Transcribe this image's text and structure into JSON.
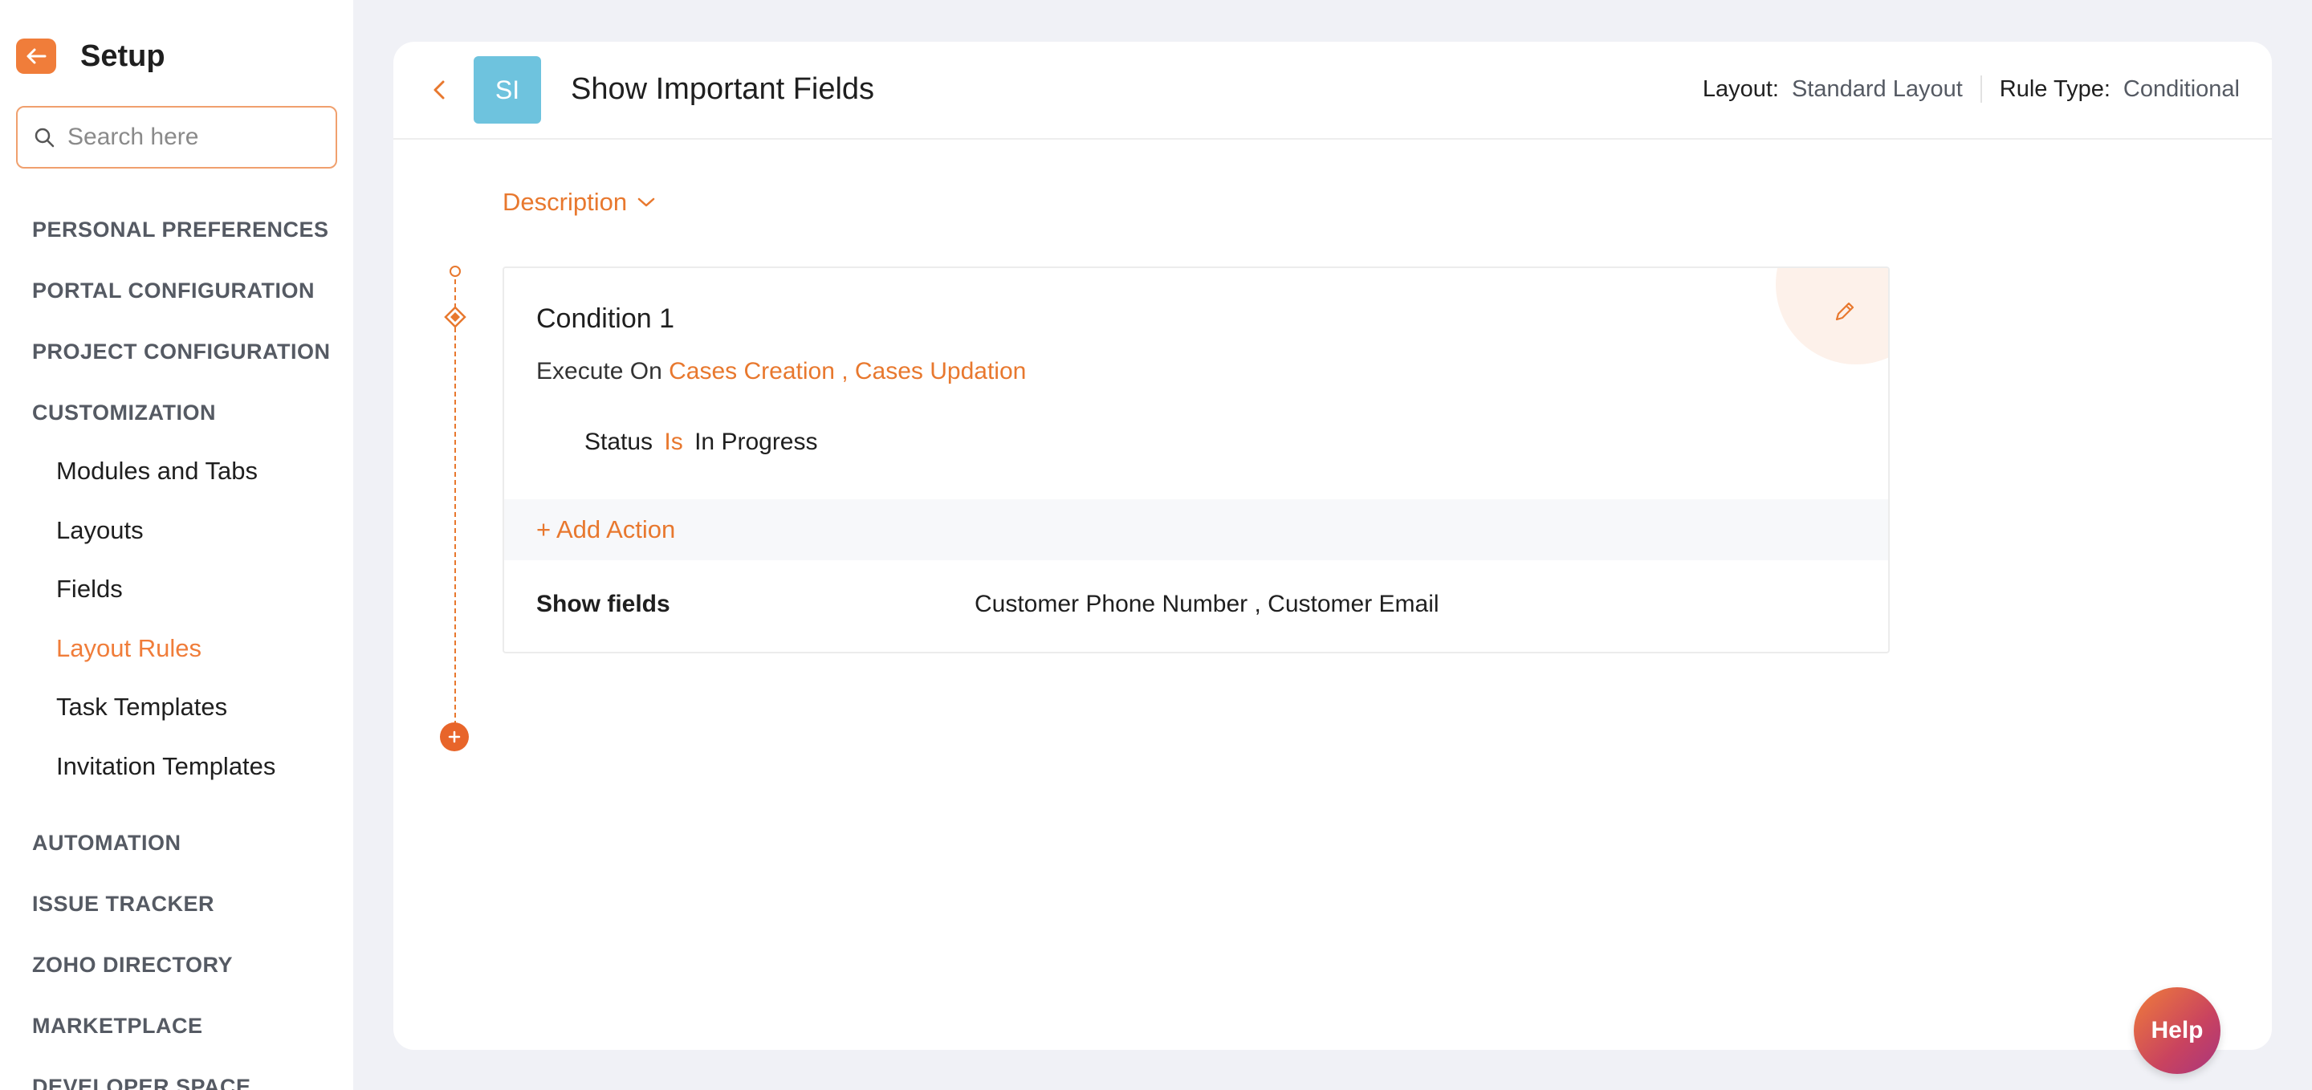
{
  "sidebar": {
    "title": "Setup",
    "search_placeholder": "Search here",
    "sections": [
      {
        "label": "PERSONAL PREFERENCES"
      },
      {
        "label": "PORTAL CONFIGURATION"
      },
      {
        "label": "PROJECT CONFIGURATION"
      },
      {
        "label": "CUSTOMIZATION"
      },
      {
        "label": "AUTOMATION"
      },
      {
        "label": "ISSUE TRACKER"
      },
      {
        "label": "ZOHO DIRECTORY"
      },
      {
        "label": "MARKETPLACE"
      },
      {
        "label": "DEVELOPER SPACE"
      }
    ],
    "customization_items": [
      {
        "label": "Modules and Tabs"
      },
      {
        "label": "Layouts"
      },
      {
        "label": "Fields"
      },
      {
        "label": "Layout Rules",
        "active": true
      },
      {
        "label": "Task Templates"
      },
      {
        "label": "Invitation Templates"
      }
    ]
  },
  "header": {
    "avatar_initials": "SI",
    "title": "Show Important Fields",
    "layout_label": "Layout:",
    "layout_value": "Standard Layout",
    "rule_type_label": "Rule Type:",
    "rule_type_value": "Conditional"
  },
  "description_label": "Description",
  "condition": {
    "title": "Condition 1",
    "execute_on_label": "Execute On",
    "execute_on_value": "Cases Creation , Cases Updation",
    "criteria": {
      "field": "Status",
      "operator": "Is",
      "value": "In Progress"
    },
    "add_action_label": "+ Add Action",
    "action": {
      "label": "Show fields",
      "value": "Customer Phone Number , Customer Email"
    }
  },
  "help_label": "Help",
  "colors": {
    "accent": "#e8782e",
    "avatar": "#6ec3de",
    "background": "#f0f1f6"
  }
}
